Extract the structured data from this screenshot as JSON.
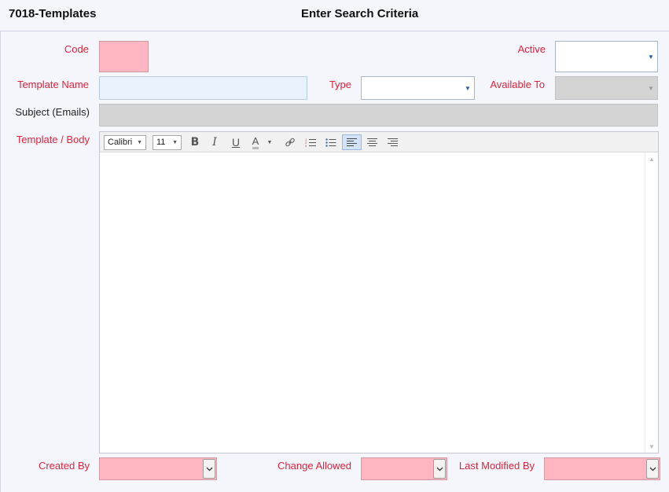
{
  "header": {
    "app_title": "7018-Templates",
    "page_title": "Enter Search Criteria"
  },
  "form": {
    "code_label": "Code",
    "active_label": "Active",
    "template_name_label": "Template Name",
    "type_label": "Type",
    "available_to_label": "Available To",
    "subject_label": "Subject (Emails)",
    "body_label": "Template / Body",
    "created_by_label": "Created By",
    "change_allowed_label": "Change Allowed",
    "last_modified_by_label": "Last Modified By"
  },
  "editor": {
    "font_name": "Calibri",
    "font_size": "11",
    "bold": "B",
    "italic": "I",
    "underline": "U",
    "font_color": "A"
  },
  "colors": {
    "required_label": "#e0223a",
    "required_field": "#ffb6c1",
    "readonly_field": "#d4d4d4",
    "focus_field": "#e8f2fd"
  },
  "icons": [
    "chevron-down-icon",
    "link-icon",
    "numbered-list-icon",
    "bullet-list-icon",
    "align-left-icon",
    "align-center-icon",
    "align-right-icon"
  ]
}
